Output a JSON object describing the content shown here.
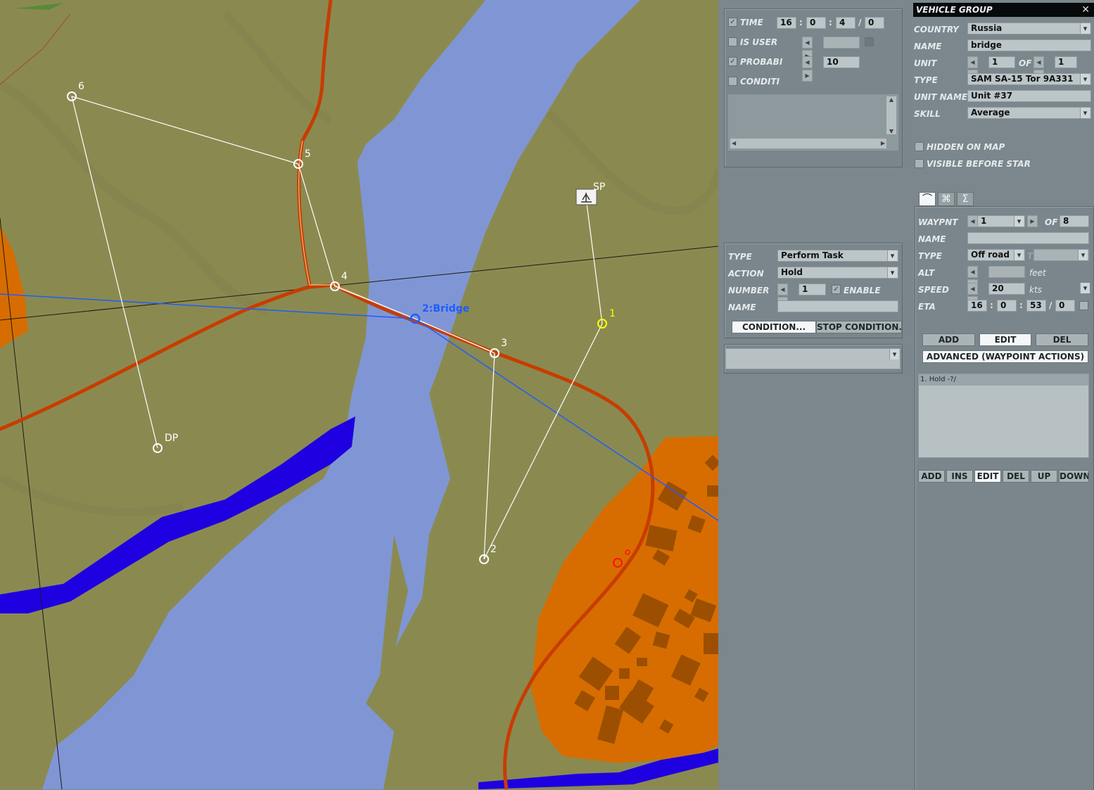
{
  "map": {
    "waypoints": [
      {
        "label": "6"
      },
      {
        "label": "5"
      },
      {
        "label": "4"
      },
      {
        "label": "3"
      },
      {
        "label": "2"
      },
      {
        "label": "1"
      },
      {
        "label": "SP"
      },
      {
        "label": "DP"
      }
    ],
    "group_label": "2:Bridge",
    "colors": {
      "terrain": "#8a8a50",
      "water": "#8096d4",
      "deep_water": "#1f00e0",
      "urban": "#d76d00",
      "road": "#c83c00",
      "route": "#ffffff",
      "group_route": "#1f5cff",
      "selected_wp": "#ffff00"
    }
  },
  "trigger_panel": {
    "time": {
      "label": "TIME",
      "h": "16",
      "m": "0",
      "s": "4",
      "d": "0",
      "sep1": ":",
      "sep2": ":",
      "sep3": "/"
    },
    "is_user": {
      "label": "IS USER"
    },
    "probability": {
      "label": "PROBABI",
      "value": "10"
    },
    "condition": {
      "label": "CONDITI"
    }
  },
  "task_panel": {
    "type": {
      "label": "TYPE",
      "value": "Perform Task"
    },
    "action": {
      "label": "ACTION",
      "value": "Hold"
    },
    "number": {
      "label": "NUMBER",
      "value": "1",
      "enable_label": "ENABLE"
    },
    "name": {
      "label": "NAME",
      "value": ""
    },
    "condition_btn": "CONDITION...",
    "stop_condition_btn": "STOP CONDITION..."
  },
  "group_panel": {
    "title": "VEHICLE GROUP",
    "close": "✕",
    "country": {
      "label": "COUNTRY",
      "value": "Russia"
    },
    "name": {
      "label": "NAME",
      "value": "bridge"
    },
    "unit": {
      "label": "UNIT",
      "value": "1",
      "of_label": "OF",
      "of_value": "1"
    },
    "type": {
      "label": "TYPE",
      "value": "SAM SA-15 Tor 9A331"
    },
    "unit_name": {
      "label": "UNIT NAME",
      "value": "Unit #37"
    },
    "skill": {
      "label": "SKILL",
      "value": "Average"
    },
    "hidden_on_map": "HIDDEN ON MAP",
    "visible_before_start": "VISIBLE BEFORE STAR"
  },
  "waypoint_panel": {
    "tabs": [
      "route-icon",
      "target-icon",
      "sigma-icon"
    ],
    "tab_glyphs": [
      "⌒",
      "⌘",
      "Σ"
    ],
    "waypnt": {
      "label": "WAYPNT",
      "value": "1",
      "of_label": "OF",
      "of_value": "8"
    },
    "name": {
      "label": "NAME",
      "value": ""
    },
    "type": {
      "label": "TYPE",
      "value": "Off road",
      "t_label": "T"
    },
    "alt": {
      "label": "ALT",
      "unit": "feet"
    },
    "speed": {
      "label": "SPEED",
      "value": "20",
      "unit": "kts"
    },
    "eta": {
      "label": "ETA",
      "h": "16",
      "m": "0",
      "s": "53",
      "d": "0",
      "sep1": ":",
      "sep2": ":",
      "sep3": "/"
    },
    "buttons": {
      "add": "ADD",
      "edit": "EDIT",
      "del": "DEL"
    },
    "advanced": "ADVANCED (WAYPOINT ACTIONS)",
    "actions": [
      "1. Hold -?/"
    ],
    "action_buttons": {
      "add": "ADD",
      "ins": "INS",
      "edit": "EDIT",
      "del": "DEL",
      "up": "UP",
      "down": "DOWN"
    }
  }
}
